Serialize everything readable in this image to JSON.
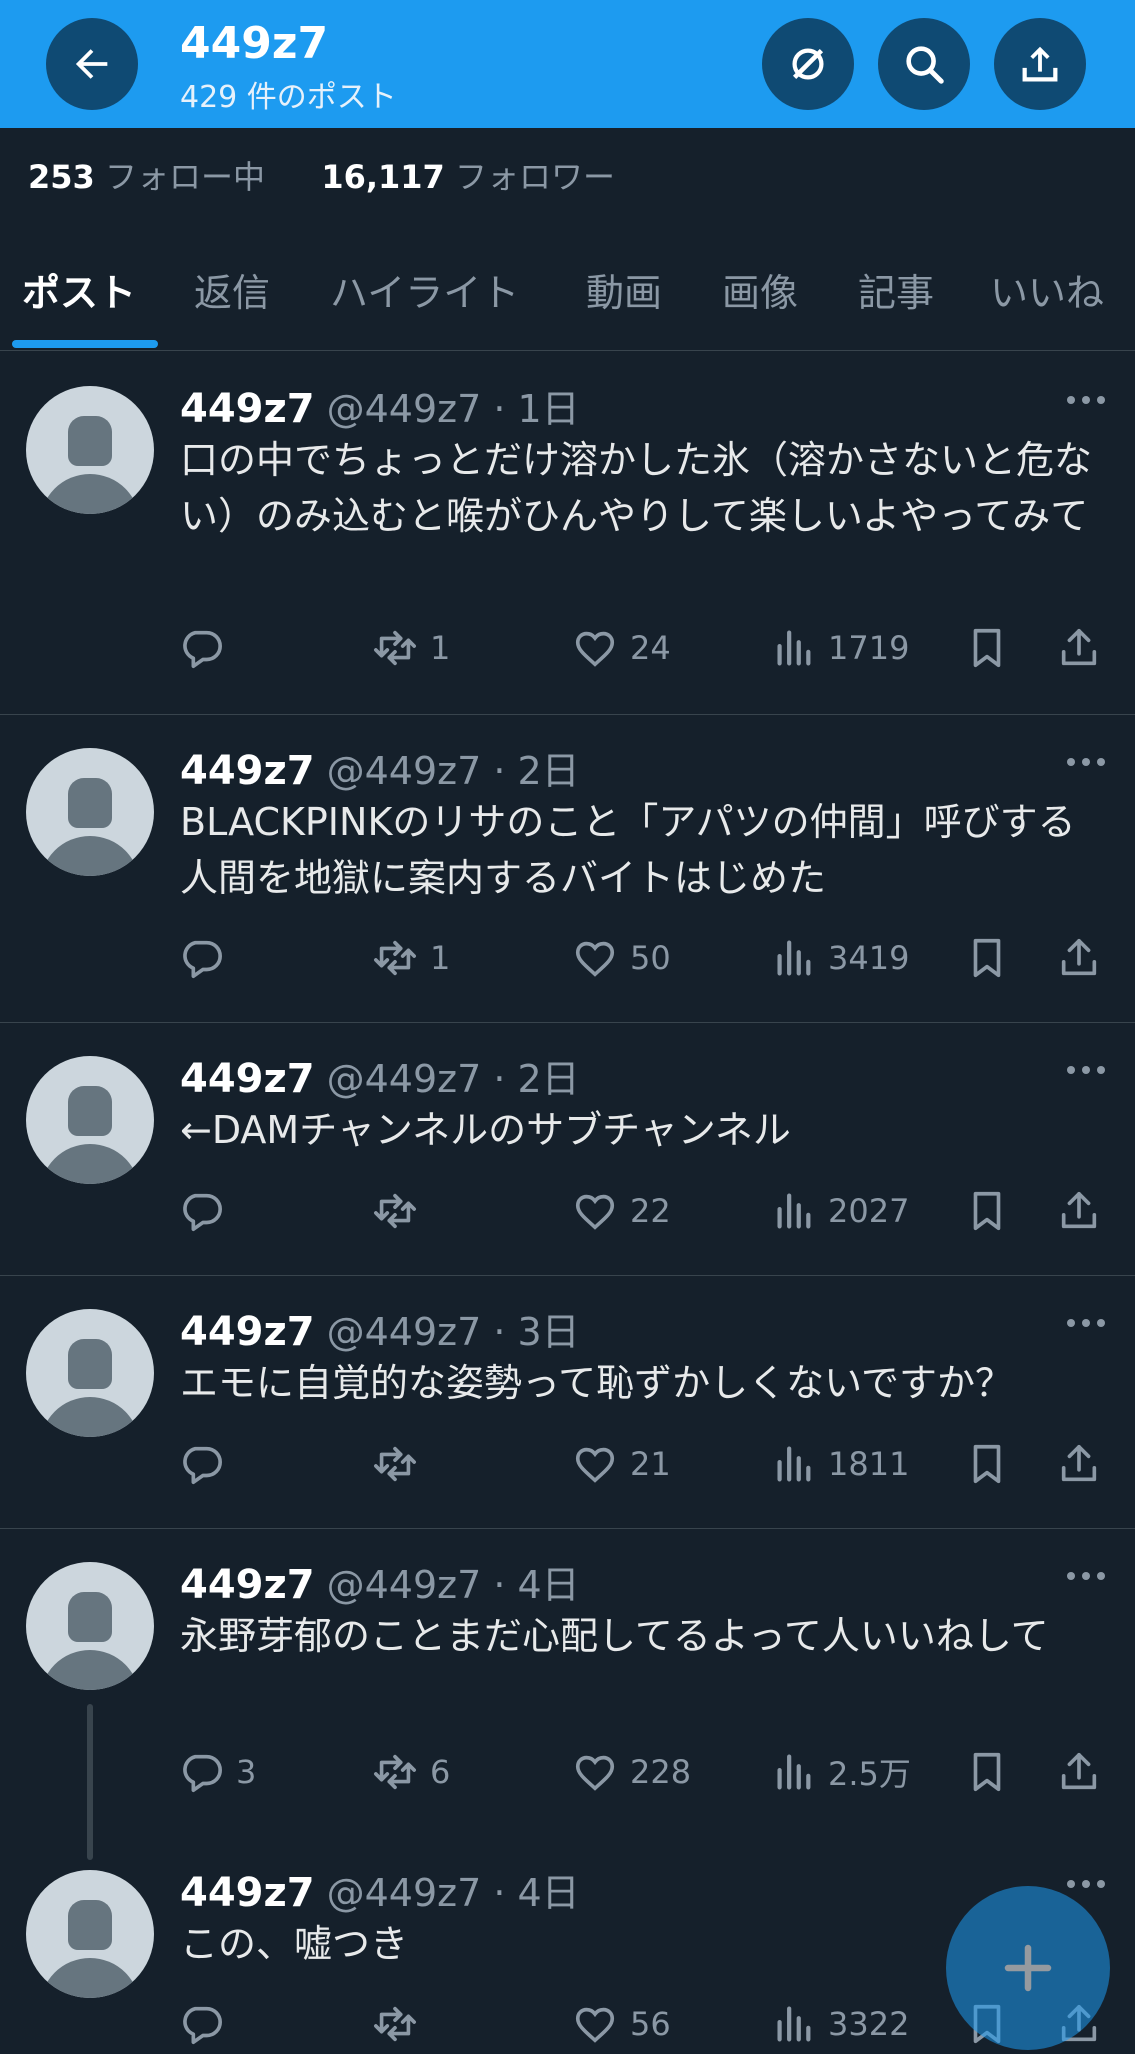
{
  "header": {
    "title": "449z7",
    "subtitle": "429 件のポスト"
  },
  "profile_stats": {
    "following_count": "253",
    "following_label": "フォロー中",
    "followers_count": "16,117",
    "followers_label": "フォロワー"
  },
  "tabs": [
    "ポスト",
    "返信",
    "ハイライト",
    "動画",
    "画像",
    "記事",
    "いいね"
  ],
  "active_tab": "ポスト",
  "posts": [
    {
      "name": "449z7",
      "meta": "@449z7 · 1日",
      "text": "口の中でちょっとだけ溶かした氷（溶かさないと危ない）のみ込むと喉がひんやりして楽しいよやってみて",
      "replies": "",
      "reposts": "1",
      "likes": "24",
      "views": "1719"
    },
    {
      "name": "449z7",
      "meta": "@449z7 · 2日",
      "text": "BLACKPINKのリサのこと「アパツの仲間」呼びする人間を地獄に案内するバイトはじめた",
      "replies": "",
      "reposts": "1",
      "likes": "50",
      "views": "3419"
    },
    {
      "name": "449z7",
      "meta": "@449z7 · 2日",
      "text": "←DAMチャンネルのサブチャンネル",
      "replies": "",
      "reposts": "",
      "likes": "22",
      "views": "2027"
    },
    {
      "name": "449z7",
      "meta": "@449z7 · 3日",
      "text": "エモに自覚的な姿勢って恥ずかしくないですか？",
      "replies": "",
      "reposts": "",
      "likes": "21",
      "views": "1811"
    },
    {
      "name": "449z7",
      "meta": "@449z7 · 4日",
      "text": "永野芽郁のことまだ心配してるよって人いいねして",
      "replies": "3",
      "reposts": "6",
      "likes": "228",
      "views": "2.5万"
    },
    {
      "name": "449z7",
      "meta": "@449z7 · 4日",
      "text": "この、嘘つき",
      "replies": "",
      "reposts": "",
      "likes": "56",
      "views": "3322"
    }
  ],
  "colors": {
    "header_bg": "#1d9bf0",
    "page_bg": "#15202b",
    "accent": "#1d9bf0",
    "muted_text": "#8b98a5"
  },
  "icons": [
    "back-arrow-icon",
    "grok-icon",
    "search-icon",
    "share-icon",
    "more-icon",
    "reply-icon",
    "repost-icon",
    "like-icon",
    "views-icon",
    "bookmark-icon",
    "compose-plus-icon"
  ]
}
